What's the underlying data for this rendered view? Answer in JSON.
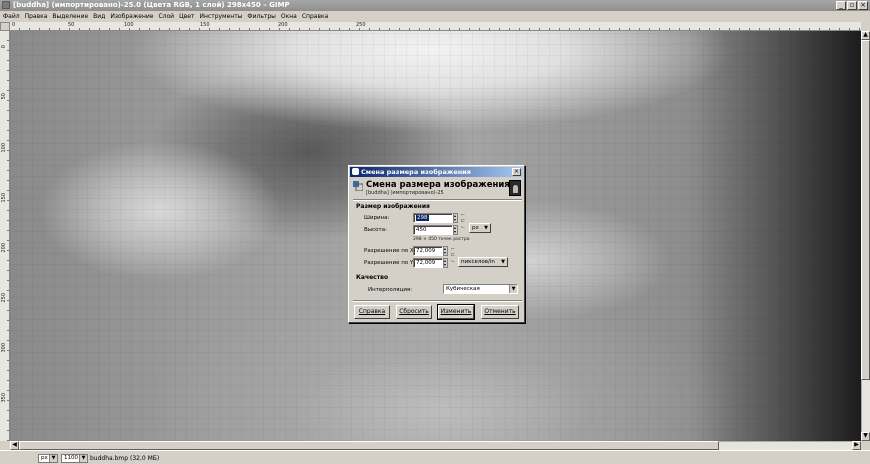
{
  "window": {
    "title": "[buddha] (импортировано)-25.0 (Цвета RGB, 1 слой) 298x450 – GIMP"
  },
  "menubar": [
    "Файл",
    "Правка",
    "Выделение",
    "Вид",
    "Изображение",
    "Слой",
    "Цвет",
    "Инструменты",
    "Фильтры",
    "Окна",
    "Справка"
  ],
  "ruler": {
    "h_ticks": [
      "0",
      "50",
      "100",
      "150",
      "200",
      "250"
    ],
    "v_ticks": [
      "0",
      "50",
      "100",
      "150",
      "200",
      "250",
      "300",
      "350"
    ]
  },
  "statusbar": {
    "unit": "px",
    "zoom": "1100 %",
    "info": "buddha.bmp (32,0 МБ)"
  },
  "dialog": {
    "title": "Смена размера изображения",
    "header": "Смена размера изображения",
    "subheader": "[buddha] (импортировано)-25",
    "size_section": "Размер изображения",
    "width_label": "Ширина:",
    "width_value": "298",
    "height_label": "Высота:",
    "height_value": "450",
    "unit": "px",
    "pixel_note": "298 × 450 точек растра",
    "xres_label": "Разрешение по X:",
    "xres_value": "72,009",
    "yres_label": "Разрешение по Y:",
    "yres_value": "72,009",
    "res_unit": "пикселов/in",
    "quality_section": "Качество",
    "interp_label": "Интерполяция:",
    "interp_value": "Кубическая",
    "buttons": {
      "help": "Справка",
      "reset": "Сбросить",
      "ok": "Изменить",
      "cancel": "Отменить"
    }
  }
}
